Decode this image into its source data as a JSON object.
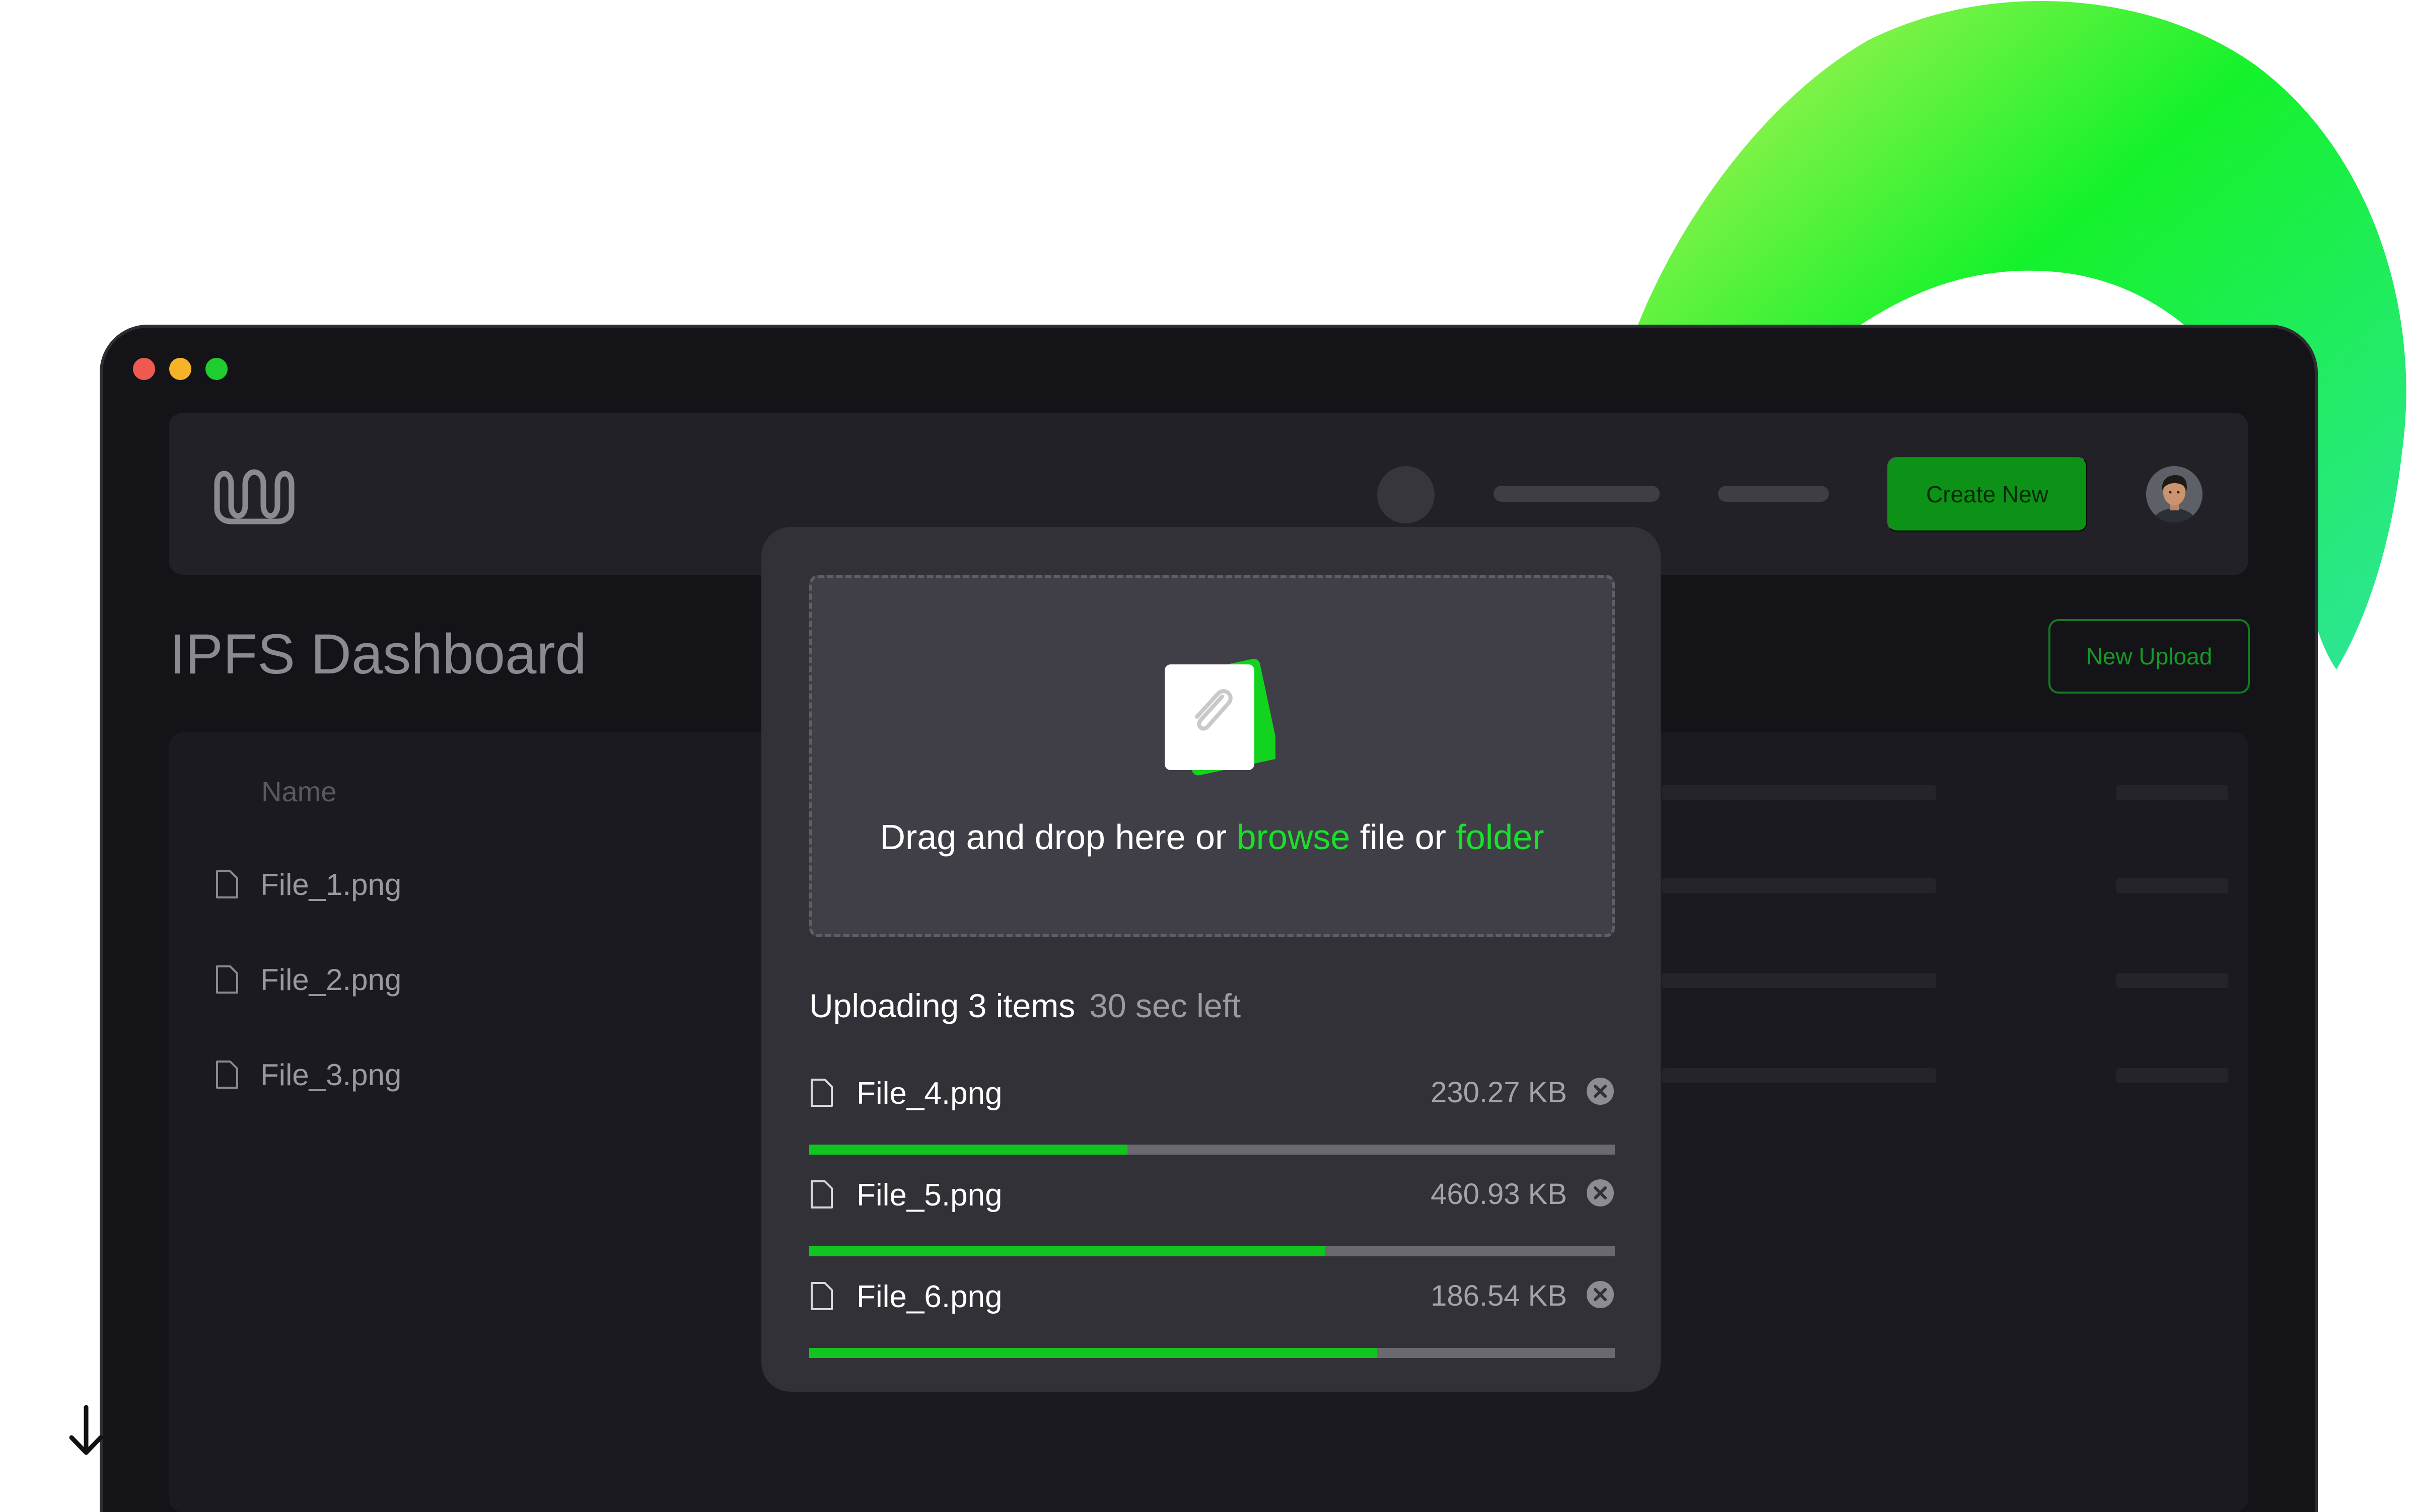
{
  "window": {
    "title": "IPFS Dashboard",
    "traffic_colors": {
      "red": "#ee5a4f",
      "yellow": "#f5b428",
      "green": "#1fce2e"
    }
  },
  "header": {
    "logo_icon": "logo-icon",
    "create_new_label": "Create New",
    "avatar_icon": "user-avatar"
  },
  "page": {
    "title": "IPFS Dashboard",
    "new_upload_label": "New Upload"
  },
  "table": {
    "column_name": "Name",
    "files": [
      {
        "name": "File_1.png",
        "icon": "file-icon"
      },
      {
        "name": "File_2.png",
        "icon": "file-icon"
      },
      {
        "name": "File_3.png",
        "icon": "file-icon"
      }
    ]
  },
  "modal": {
    "dropzone": {
      "icon": "attachment-icon",
      "text_pre": "Drag and drop here or ",
      "browse_label": "browse",
      "text_mid": " file or ",
      "folder_label": "folder"
    },
    "status": {
      "count_text": "Uploading 3 items",
      "eta_text": "30 sec left"
    },
    "uploads": [
      {
        "name": "File_4.png",
        "size": "230.27 KB",
        "progress": 0.395
      },
      {
        "name": "File_5.png",
        "size": "460.93 KB",
        "progress": 0.64
      },
      {
        "name": "File_6.png",
        "size": "186.54 KB",
        "progress": 0.705
      }
    ]
  },
  "colors": {
    "accent": "#19e02a",
    "primary_button": "#0c9216",
    "background": "#141318"
  },
  "icons": {
    "scroll_hint": "arrow-down-icon",
    "remove": "close-circle-icon"
  }
}
